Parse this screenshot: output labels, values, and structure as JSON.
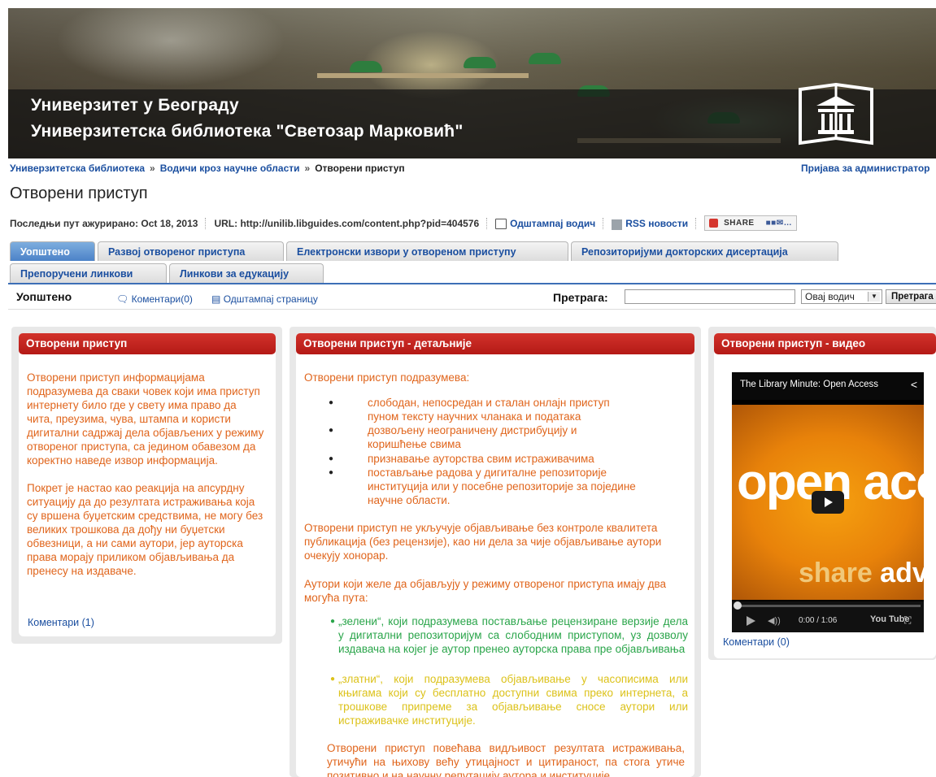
{
  "banner": {
    "line1": "Универзитет у Београду",
    "line2": "Универзитетска библиотека \"Светозар Марковић\""
  },
  "breadcrumb": {
    "item1": "Универзитетска библиотека",
    "item2": "Водичи кроз научне области",
    "item3": "Отворени приступ",
    "sep": "»"
  },
  "admin_login": "Пријава за администратор",
  "page_title": "Отворени приступ",
  "meta": {
    "updated_label": "Последњи пут ажурирано: Oct 18, 2013",
    "url_label": "URL: http://unilib.libguides.com/content.php?pid=404576",
    "print_guide": "Одштампај водич",
    "rss": "RSS новости",
    "share": "SHARE"
  },
  "tabs": [
    {
      "label": "Уопштено"
    },
    {
      "label": "Развој отвореног приступа"
    },
    {
      "label": "Електронски извори у отвореном приступу"
    },
    {
      "label": "Репозиторијуми докторских дисертација"
    },
    {
      "label": "Препоручени линкови"
    },
    {
      "label": "Линкови за едукацију"
    }
  ],
  "subbar": {
    "heading": "Уопштено",
    "comments": "Коментари(0)",
    "print_page": "Одштампај страницу",
    "search_label": "Претрага:",
    "search_value": "",
    "scope": "Овај водич",
    "search_button": "Претрага"
  },
  "box1": {
    "title": "Отворени приступ",
    "p1": "Отворени приступ информацијама подразумева да сваки човек који има приступ интернету било где у свету има право да чита, преузима, чува, штампа и користи дигитални садржај дела објављених у режиму отвореног приступа, са једином обавезом да коректно наведе извор информација.",
    "p2": "Покрет је настао као реакција на апсурдну ситуацију да до резултата истраживања која су вршена буџетским средствима, не могу без великих трошкова да дођу ни буџетски обвезници, а ни сами аутори, јер ауторска права морају приликом објављивања да пренесу на издаваче.",
    "comments": "Коментари (1)"
  },
  "box2": {
    "title": "Отворени приступ - детаљније",
    "intro": "Отворени приступ подразумева:",
    "bullets": [
      "слободан, непосредан и сталан онлајн приступ пуном тексту научних чланака и података",
      "дозвољену неограничену дистрибуцију и коришћење свима",
      "признавање ауторства свим истраживачима",
      "постављање радова у дигиталне репозиторије институција или у посебне репозиторије за поједине научне области."
    ],
    "p2": "Отворени приступ не укључује објављивање без контроле квалитета публикација (без рецензије), као ни дела за чије објављивање аутори очекују хонорар.",
    "p3": "Аутори који желе да објављују у режиму отвореног приступа имају два могућа пута:",
    "green": "„зелени“, који подразумева постављање рецензиране верзије дела у дигитални репозиторијум са слободним приступом, уз дозволу издавача на којег је аутор пренео ауторска права пре објављивања",
    "gold": "„златни“, који подразумева објављивање у часописима или књигама који су бесплатно доступни свима преко интернета, а трошкове припреме за објављивање сносе аутори или истраживачке институције.",
    "p4": "Отворени приступ повећава видљивост резултата истраживања, утичући на њихову већу утицајност и цитираност, па стога утиче позитивно и на научну репутацију аутора и институције."
  },
  "box3": {
    "title": "Отворени приступ - видео",
    "video_title": "The Library Minute: Open Access",
    "frame_text1": "open acc",
    "frame_text2a": "share",
    "frame_text2b": " adva",
    "time": "0:00 / 1:06",
    "yt": "You Tube",
    "comments": "Коментари (0)"
  }
}
